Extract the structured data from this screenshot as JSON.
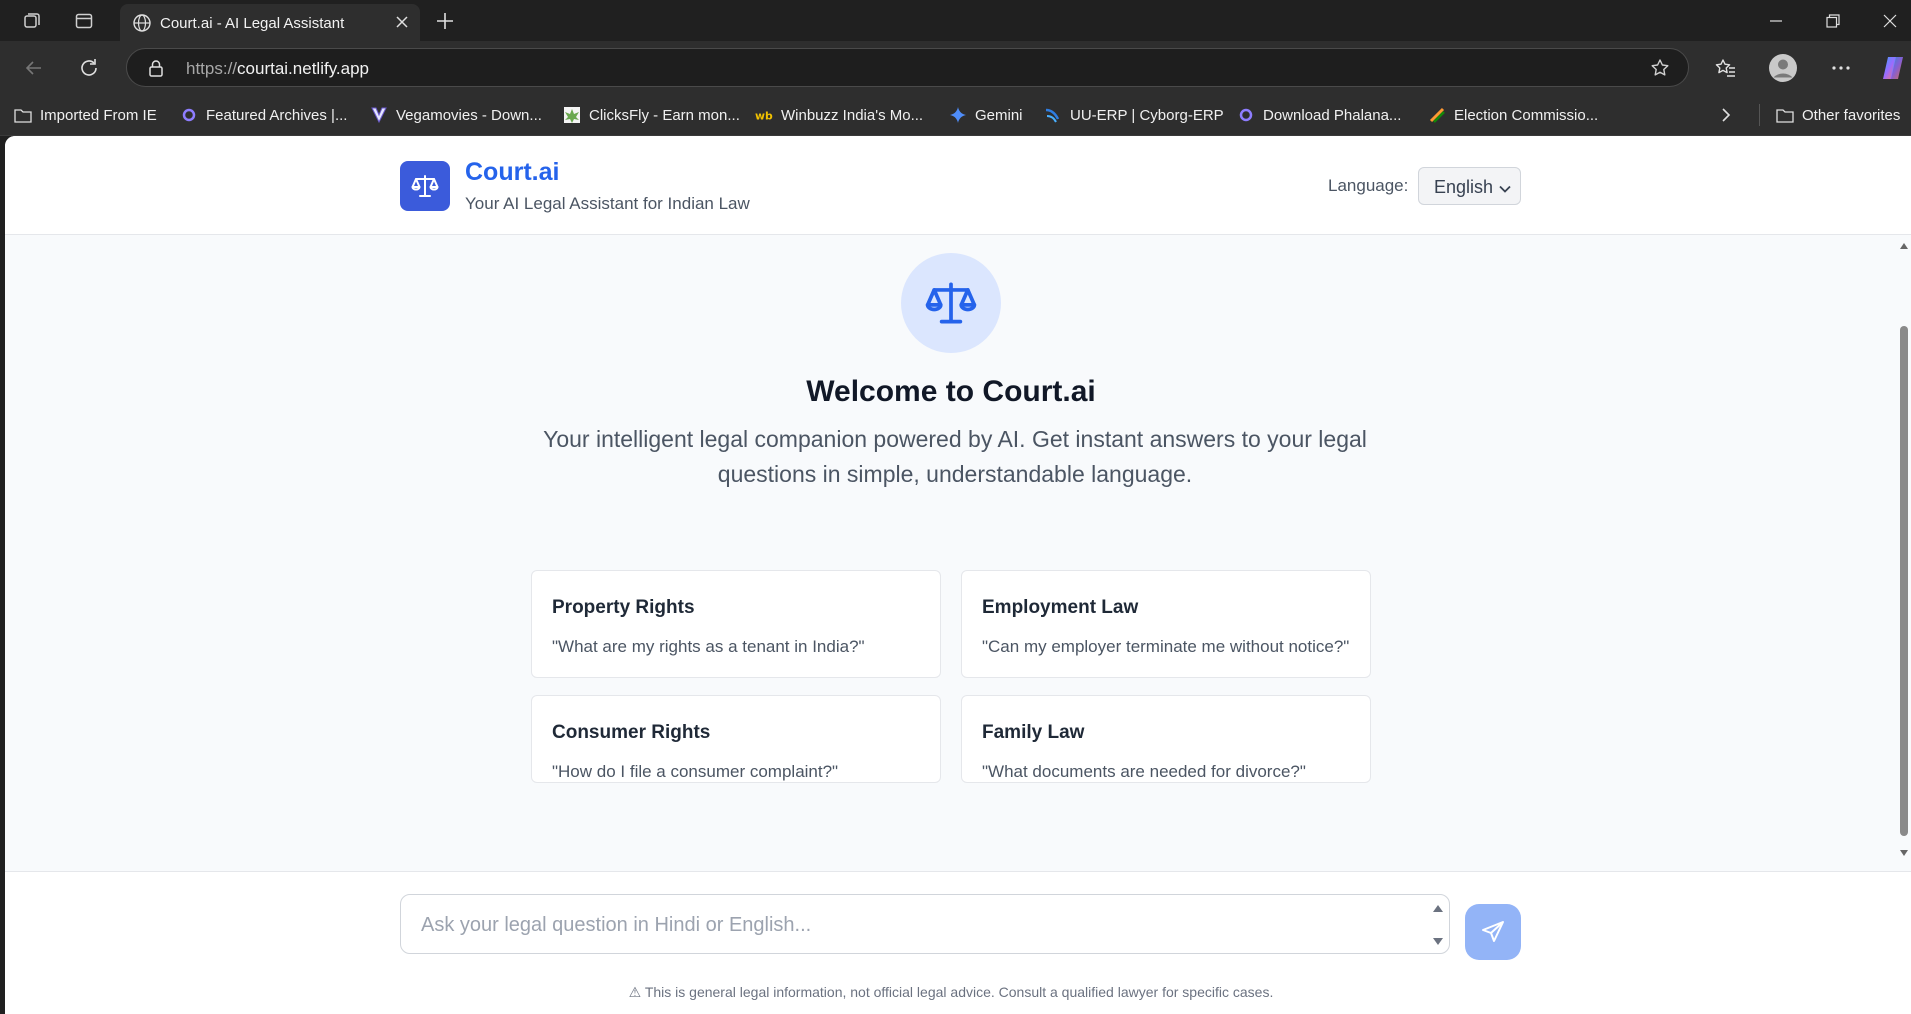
{
  "browser": {
    "tab_title": "Court.ai - AI Legal Assistant",
    "url_scheme": "https://",
    "url_host": "courtai.netlify.app",
    "bookmarks": [
      {
        "label": "Imported From IE",
        "icon": "folder-icon"
      },
      {
        "label": "Featured Archives |...",
        "icon": "site-icon"
      },
      {
        "label": "Vegamovies - Down...",
        "icon": "v-logo-icon"
      },
      {
        "label": "ClicksFly - Earn mon...",
        "icon": "site-icon"
      },
      {
        "label": "Winbuzz India's Mo...",
        "icon": "wb-logo-icon"
      },
      {
        "label": "Gemini",
        "icon": "gemini-sparkle-icon"
      },
      {
        "label": "UU-ERP | Cyborg-ERP",
        "icon": "site-icon"
      },
      {
        "label": "Download Phalana...",
        "icon": "site-icon"
      },
      {
        "label": "Election Commissio...",
        "icon": "site-icon"
      }
    ],
    "other_favorites": "Other favorites"
  },
  "header": {
    "brand": "Court.ai",
    "tagline": "Your AI Legal Assistant for Indian Law",
    "language_label": "Language:",
    "language_value": "English"
  },
  "hero": {
    "title": "Welcome to Court.ai",
    "intro": "Your intelligent legal companion powered by AI. Get instant answers to your legal questions in simple, understandable language."
  },
  "cards": [
    {
      "title": "Property Rights",
      "question": "\"What are my rights as a tenant in India?\""
    },
    {
      "title": "Employment Law",
      "question": "\"Can my employer terminate me without notice?\""
    },
    {
      "title": "Consumer Rights",
      "question": "\"How do I file a consumer complaint?\""
    },
    {
      "title": "Family Law",
      "question": "\"What documents are needed for divorce?\""
    }
  ],
  "composer": {
    "placeholder": "Ask your legal question in Hindi or English...",
    "disclaimer": "⚠ This is general legal information, not official legal advice. Consult a qualified lawyer for specific cases."
  },
  "colors": {
    "brand_blue": "#2563eb",
    "logo_bg": "#3b5bdb",
    "send_button": "#93b4f7"
  }
}
